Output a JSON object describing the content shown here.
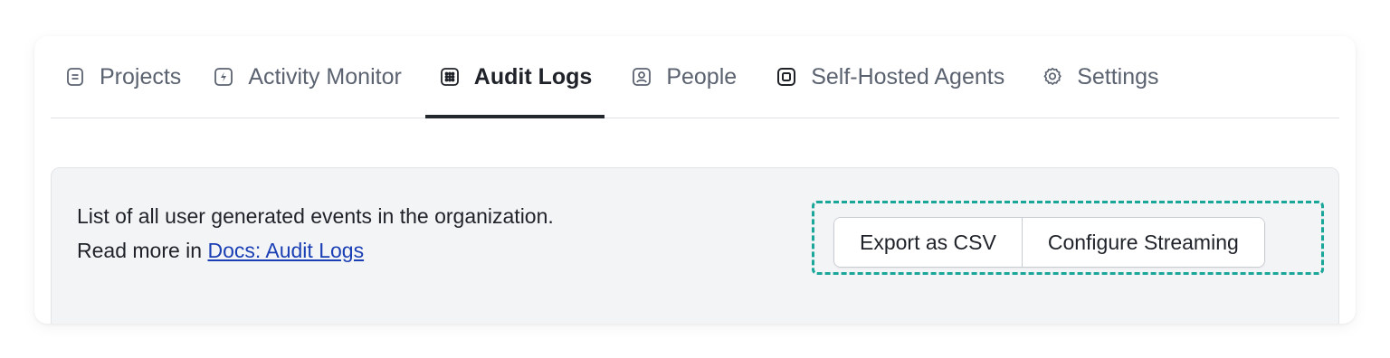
{
  "tabs": [
    {
      "label": "Projects",
      "icon": "projects-icon",
      "active": false
    },
    {
      "label": "Activity Monitor",
      "icon": "activity-icon",
      "active": false
    },
    {
      "label": "Audit Logs",
      "icon": "audit-logs-icon",
      "active": true
    },
    {
      "label": "People",
      "icon": "people-icon",
      "active": false
    },
    {
      "label": "Self-Hosted Agents",
      "icon": "agents-icon",
      "active": false
    },
    {
      "label": "Settings",
      "icon": "gear-icon",
      "active": false
    }
  ],
  "info": {
    "description": "List of all user generated events in the organization.",
    "read_more_prefix": "Read more in ",
    "docs_link": "Docs: Audit Logs"
  },
  "actions": {
    "export_label": "Export as CSV",
    "streaming_label": "Configure Streaming"
  },
  "colors": {
    "highlight_outline": "#1aa79a",
    "link": "#1a3fb5",
    "active_tab_underline": "#23272e"
  }
}
